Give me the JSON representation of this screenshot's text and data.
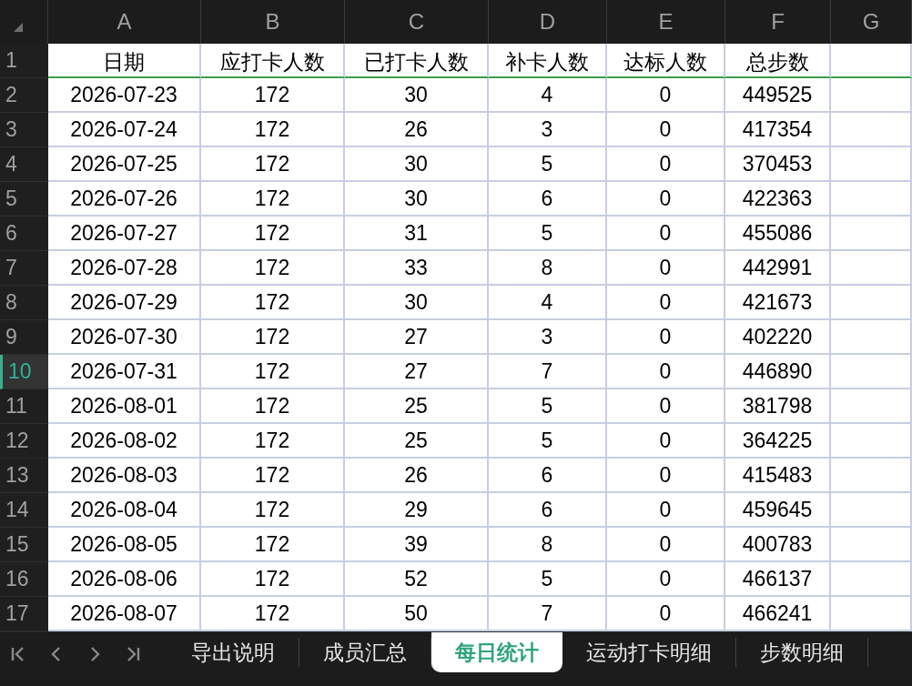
{
  "sheet": {
    "columns": [
      "A",
      "B",
      "C",
      "D",
      "E",
      "F",
      "G"
    ],
    "rows": [
      {
        "number": "1",
        "selected": false,
        "kind": "header",
        "cells": [
          "日期",
          "应打卡人数",
          "已打卡人数",
          "补卡人数",
          "达标人数",
          "总步数"
        ]
      },
      {
        "number": "2",
        "selected": false,
        "kind": "data",
        "cells": [
          "2026-07-23",
          "172",
          "30",
          "4",
          "0",
          "449525"
        ]
      },
      {
        "number": "3",
        "selected": false,
        "kind": "data",
        "cells": [
          "2026-07-24",
          "172",
          "26",
          "3",
          "0",
          "417354"
        ]
      },
      {
        "number": "4",
        "selected": false,
        "kind": "data",
        "cells": [
          "2026-07-25",
          "172",
          "30",
          "5",
          "0",
          "370453"
        ]
      },
      {
        "number": "5",
        "selected": false,
        "kind": "data",
        "cells": [
          "2026-07-26",
          "172",
          "30",
          "6",
          "0",
          "422363"
        ]
      },
      {
        "number": "6",
        "selected": false,
        "kind": "data",
        "cells": [
          "2026-07-27",
          "172",
          "31",
          "5",
          "0",
          "455086"
        ]
      },
      {
        "number": "7",
        "selected": false,
        "kind": "data",
        "cells": [
          "2026-07-28",
          "172",
          "33",
          "8",
          "0",
          "442991"
        ]
      },
      {
        "number": "8",
        "selected": false,
        "kind": "data",
        "cells": [
          "2026-07-29",
          "172",
          "30",
          "4",
          "0",
          "421673"
        ]
      },
      {
        "number": "9",
        "selected": false,
        "kind": "data",
        "cells": [
          "2026-07-30",
          "172",
          "27",
          "3",
          "0",
          "402220"
        ]
      },
      {
        "number": "10",
        "selected": true,
        "kind": "data",
        "cells": [
          "2026-07-31",
          "172",
          "27",
          "7",
          "0",
          "446890"
        ]
      },
      {
        "number": "11",
        "selected": false,
        "kind": "data",
        "cells": [
          "2026-08-01",
          "172",
          "25",
          "5",
          "0",
          "381798"
        ]
      },
      {
        "number": "12",
        "selected": false,
        "kind": "data",
        "cells": [
          "2026-08-02",
          "172",
          "25",
          "5",
          "0",
          "364225"
        ]
      },
      {
        "number": "13",
        "selected": false,
        "kind": "data",
        "cells": [
          "2026-08-03",
          "172",
          "26",
          "6",
          "0",
          "415483"
        ]
      },
      {
        "number": "14",
        "selected": false,
        "kind": "data",
        "cells": [
          "2026-08-04",
          "172",
          "29",
          "6",
          "0",
          "459645"
        ]
      },
      {
        "number": "15",
        "selected": false,
        "kind": "data",
        "cells": [
          "2026-08-05",
          "172",
          "39",
          "8",
          "0",
          "400783"
        ]
      },
      {
        "number": "16",
        "selected": false,
        "kind": "data",
        "cells": [
          "2026-08-06",
          "172",
          "52",
          "5",
          "0",
          "466137"
        ]
      },
      {
        "number": "17",
        "selected": false,
        "kind": "data",
        "cells": [
          "2026-08-07",
          "172",
          "50",
          "7",
          "0",
          "466241"
        ]
      }
    ]
  },
  "sheet_tabs": [
    {
      "label": "导出说明",
      "selected": false
    },
    {
      "label": "成员汇总",
      "selected": false
    },
    {
      "label": "每日统计",
      "selected": true
    },
    {
      "label": "运动打卡明细",
      "selected": false
    },
    {
      "label": "步数明细",
      "selected": false
    }
  ]
}
